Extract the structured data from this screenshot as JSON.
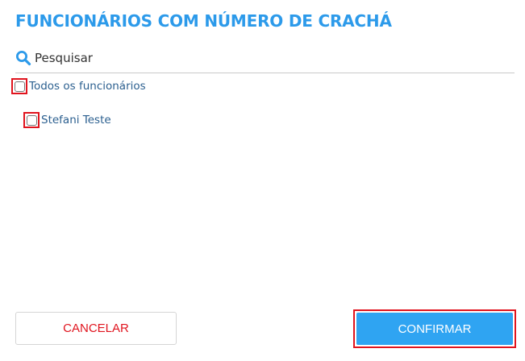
{
  "dialog": {
    "title": "FUNCIONÁRIOS COM NÚMERO DE CRACHÁ"
  },
  "search": {
    "placeholder": "Pesquisar",
    "icon": "search-icon"
  },
  "options": [
    {
      "label": "Todos os funcionários",
      "checked": false
    },
    {
      "label": "Stefani Teste",
      "checked": false
    }
  ],
  "footer": {
    "cancel_label": "CANCELAR",
    "confirm_label": "CONFIRMAR"
  },
  "colors": {
    "title": "#2c9aea",
    "label": "#2b5f8f",
    "highlight": "#e0141e",
    "confirm_bg": "#2fa4f2",
    "cancel_text": "#e0141e"
  }
}
